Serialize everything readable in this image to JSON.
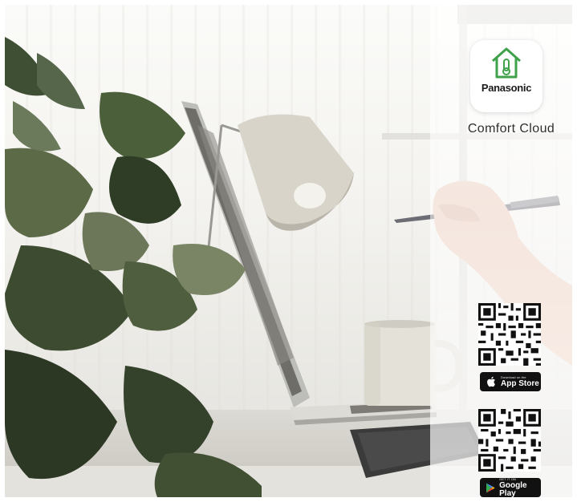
{
  "brand": {
    "app_icon": "house-thermometer-icon",
    "brand_label": "Panasonic",
    "app_name": "Comfort Cloud",
    "accent_green": "#3fa24a"
  },
  "downloads": {
    "app_store": {
      "qr_icon": "qr-code",
      "badge_small": "Download on the",
      "badge_big": "App Store",
      "icon": "apple-icon"
    },
    "google_play": {
      "qr_icon": "qr-code",
      "badge_small": "GET IT ON",
      "badge_big": "Google Play",
      "icon": "google-play-icon"
    }
  },
  "scene": {
    "objects": [
      "plant",
      "desk-lamp",
      "laptop",
      "mug",
      "hand-with-pen",
      "keyboard"
    ]
  }
}
